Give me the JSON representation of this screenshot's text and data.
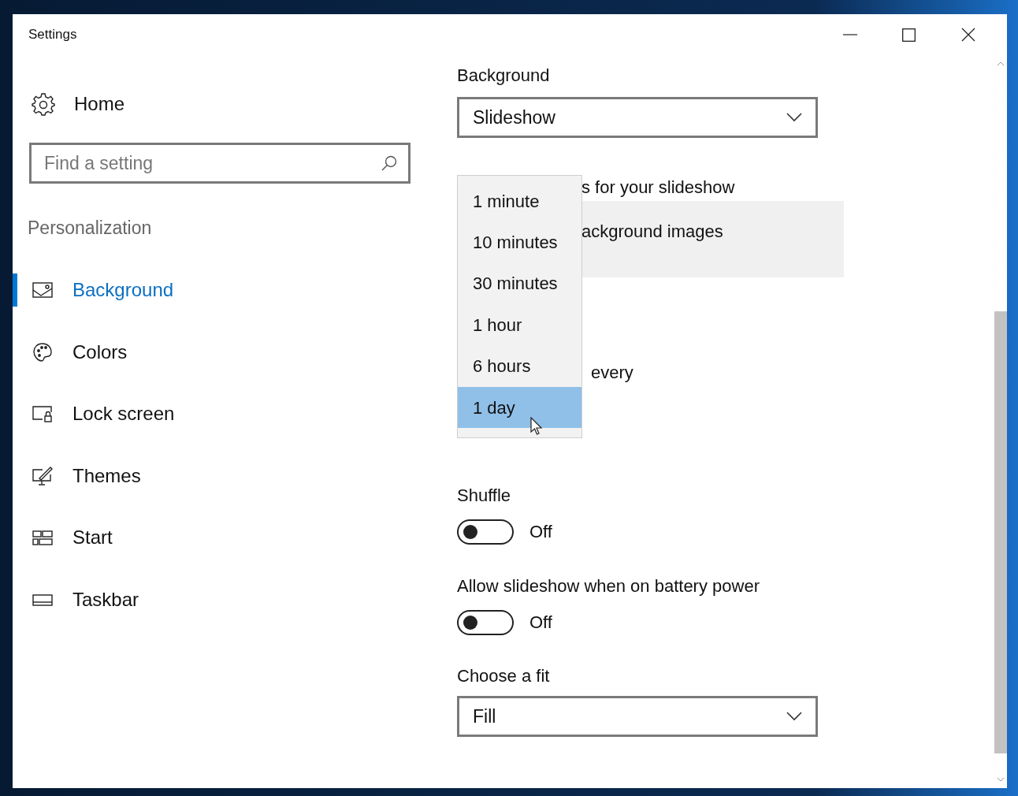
{
  "window": {
    "title": "Settings"
  },
  "sidebar": {
    "home": "Home",
    "search": {
      "placeholder": "Find a setting"
    },
    "section": "Personalization",
    "items": [
      {
        "label": "Background",
        "selected": true
      },
      {
        "label": "Colors",
        "selected": false
      },
      {
        "label": "Lock screen",
        "selected": false
      },
      {
        "label": "Themes",
        "selected": false
      },
      {
        "label": "Start",
        "selected": false
      },
      {
        "label": "Taskbar",
        "selected": false
      }
    ]
  },
  "content": {
    "background": {
      "label": "Background",
      "value": "Slideshow"
    },
    "albums": {
      "label": "s for your slideshow",
      "folder": "ackground images"
    },
    "interval": {
      "label": "every",
      "options": [
        {
          "label": "1 minute",
          "selected": false
        },
        {
          "label": "10 minutes",
          "selected": false
        },
        {
          "label": "30 minutes",
          "selected": false
        },
        {
          "label": "1 hour",
          "selected": false
        },
        {
          "label": "6 hours",
          "selected": false
        },
        {
          "label": "1 day",
          "selected": true
        }
      ]
    },
    "toggles": [
      {
        "label": "Shuffle",
        "on": false,
        "state": "Off"
      },
      {
        "label": "Allow slideshow when on battery power",
        "on": false,
        "state": "Off"
      }
    ],
    "fit": {
      "label": "Choose a fit",
      "value": "Fill"
    }
  }
}
